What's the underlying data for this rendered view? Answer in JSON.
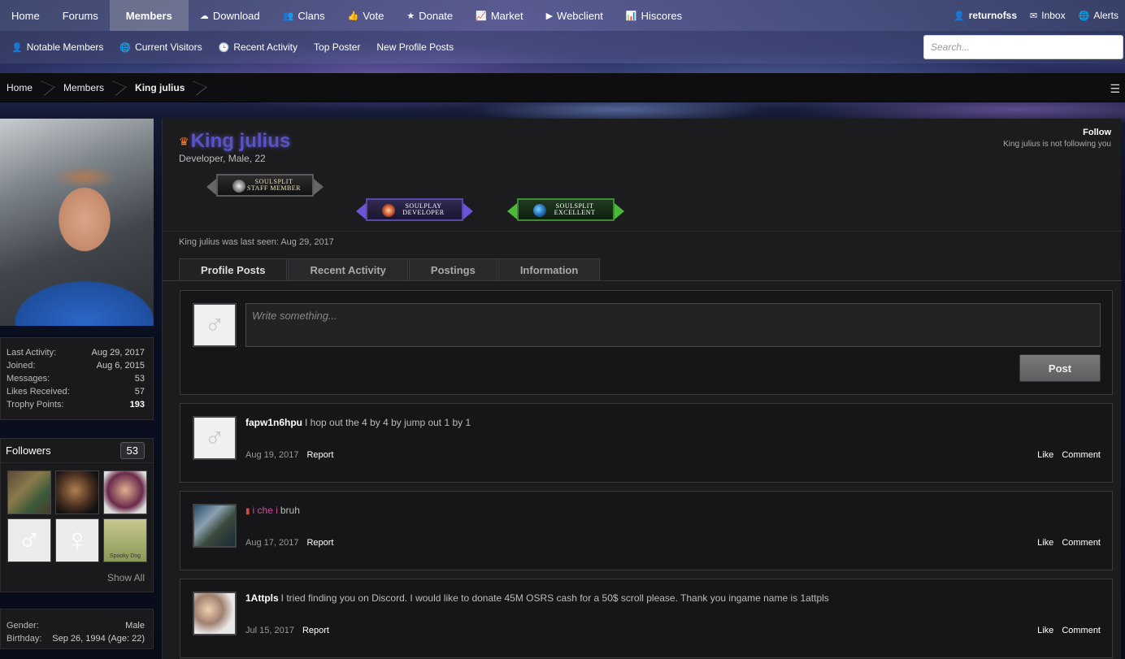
{
  "topnav": {
    "items": [
      {
        "label": "Home",
        "icon": ""
      },
      {
        "label": "Forums",
        "icon": ""
      },
      {
        "label": "Members",
        "icon": ""
      },
      {
        "label": "Download",
        "icon": "cloud-download-icon"
      },
      {
        "label": "Clans",
        "icon": "users-icon"
      },
      {
        "label": "Vote",
        "icon": "thumbs-up-icon"
      },
      {
        "label": "Donate",
        "icon": "star-icon"
      },
      {
        "label": "Market",
        "icon": "line-chart-icon"
      },
      {
        "label": "Webclient",
        "icon": "play-icon"
      },
      {
        "label": "Hiscores",
        "icon": "bar-chart-icon"
      }
    ],
    "user": "returnofss",
    "inbox": "Inbox",
    "alerts": "Alerts"
  },
  "subnav": {
    "items": [
      "Notable Members",
      "Current Visitors",
      "Recent Activity",
      "Top Poster",
      "New Profile Posts"
    ],
    "search_placeholder": "Search..."
  },
  "breadcrumb": [
    "Home",
    "Members",
    "King julius"
  ],
  "sidebar": {
    "stats": [
      {
        "label": "Last Activity:",
        "value": "Aug 29, 2017"
      },
      {
        "label": "Joined:",
        "value": "Aug 6, 2015"
      },
      {
        "label": "Messages:",
        "value": "53"
      },
      {
        "label": "Likes Received:",
        "value": "57"
      },
      {
        "label": "Trophy Points:",
        "value": "193"
      }
    ],
    "followers": {
      "title": "Followers",
      "count": "53",
      "show_all": "Show All",
      "spooky_label": "Spooky Dog"
    },
    "identity": [
      {
        "label": "Gender:",
        "value": "Male"
      },
      {
        "label": "Birthday:",
        "value": "Sep 26, 1994 (Age: 22)"
      }
    ]
  },
  "profile": {
    "name": "King julius",
    "subtitle": "Developer, Male, 22",
    "follow": "Follow",
    "follow_note": "King julius is not following you",
    "badges": [
      {
        "line1": "SOULSPLIT",
        "line2": "STAFF MEMBER"
      },
      {
        "line1": "SOULPLAY",
        "line2": "DEVELOPER"
      },
      {
        "line1": "SOULSPLIT",
        "line2": "EXCELLENT"
      }
    ],
    "last_seen": "King julius was last seen: Aug 29, 2017"
  },
  "tabs": [
    "Profile Posts",
    "Recent Activity",
    "Postings",
    "Information"
  ],
  "postbox": {
    "placeholder": "Write something...",
    "button": "Post"
  },
  "posts": [
    {
      "user": "fapw1n6hpu",
      "text": "I hop out the 4 by 4 by jump out 1 by 1",
      "date": "Aug 19, 2017",
      "report": "Report",
      "like": "Like",
      "comment": "Comment"
    },
    {
      "user": "i che i",
      "text": "bruh",
      "date": "Aug 17, 2017",
      "report": "Report",
      "like": "Like",
      "comment": "Comment"
    },
    {
      "user": "1Attpls",
      "text": "I tried finding you on Discord. I would like to donate 45M OSRS cash for a 50$ scroll please. Thank you ingame name is 1attpls",
      "date": "Jul 15, 2017",
      "report": "Report",
      "like": "Like",
      "comment": "Comment"
    }
  ]
}
